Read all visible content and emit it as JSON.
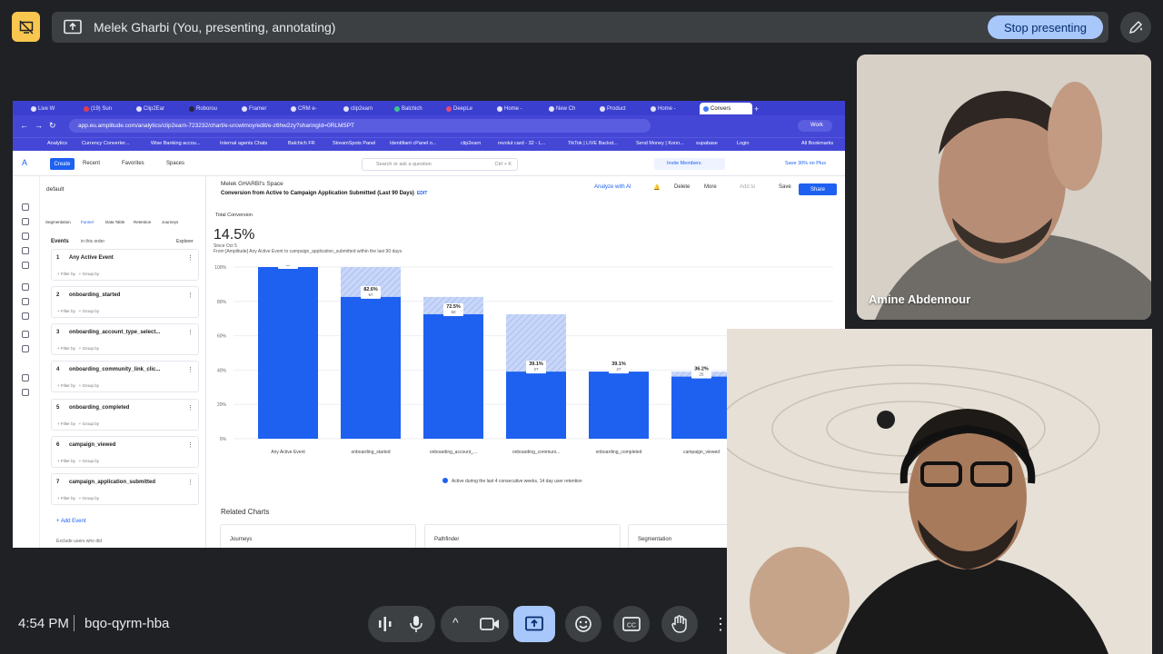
{
  "meeting": {
    "presenting_label": "Melek Gharbi (You, presenting, annotating)",
    "stop_button": "Stop presenting",
    "time": "4:54 PM",
    "code": "bqo-qyrm-hba"
  },
  "participants": [
    {
      "name": "Amine Abdennour"
    }
  ],
  "browser": {
    "tabs": [
      "Live W",
      "(19) Sun",
      "Clip2Ear",
      "Roborou",
      "Framer",
      "CRM e-",
      "clip2earn",
      "Balchich",
      "DeepLe",
      "Home -",
      "New Ch",
      "Product",
      "Home -",
      "Convers"
    ],
    "url": "app.eu.amplitude.com/analytics/clip2earn-723232/chart/e-urcwtmoy/edit/e-z6hw2zy?sharingId=0RLMSPT",
    "profile": "Work",
    "bookmarks": [
      "Analytics",
      "Currency Converter...",
      "Wise Banking accou...",
      "Internal agents Chats",
      "Balchich FR",
      "StreamSpots Panel",
      "Identifiant cPanel o...",
      "clip2earn",
      "revolut card - 32 - L...",
      "TikTok | LIVE Backst...",
      "Send Money | Konn...",
      "supabase",
      "Login",
      "All Bookmarks"
    ]
  },
  "app": {
    "create": "Create",
    "nav": [
      "Recent",
      "Favorites",
      "Spaces"
    ],
    "search_placeholder": "Search or ask a question",
    "search_shortcut": "Ctrl + K",
    "invite": "Invite Members",
    "save_promo": "Save 30% on Plus",
    "project": "default",
    "left_tabs": [
      "Segmentation",
      "Funnel",
      "Data Table",
      "Retention",
      "Journeys"
    ],
    "events_label": "Events",
    "order_label": "in this order",
    "explorer": "Explorer",
    "filter_by": "+ Filter by",
    "group_by": "+ Group by",
    "events": [
      {
        "num": "1",
        "name": "Any Active Event"
      },
      {
        "num": "2",
        "name": "onboarding_started"
      },
      {
        "num": "3",
        "name": "onboarding_account_type_select..."
      },
      {
        "num": "4",
        "name": "onboarding_community_link_clic..."
      },
      {
        "num": "5",
        "name": "onboarding_completed"
      },
      {
        "num": "6",
        "name": "campaign_viewed"
      },
      {
        "num": "7",
        "name": "campaign_application_submitted"
      }
    ],
    "add_event": "+ Add Event",
    "exclude": "Exclude users who did",
    "crumb": "Melek GHARBI's Space",
    "chart_title": "Conversion from Active to Campaign Application Submitted (Last 90 Days)",
    "edit_tag": "EDIT",
    "analyze_ai": "Analyze with AI",
    "delete": "Delete",
    "more": "More",
    "add_to": "Add to",
    "save": "Save",
    "share": "Share",
    "total_conversion": "Total Conversion",
    "headline_pct": "14.5%",
    "since": "Since Oct 5",
    "from_to": "From [Amplitude] Any Active Event to campaign_application_submitted within the last 90 days.",
    "legend": "Active during the last 4 consecutive weeks, 14 day user retention",
    "related": "Related Charts",
    "related_cards": [
      "Journeys",
      "Pathfinder",
      "Segmentation"
    ]
  },
  "chart_data": {
    "type": "bar",
    "categories": [
      "Any Active Event",
      "onboarding_started",
      "onboarding_account_...",
      "onboarding_communi...",
      "onboarding_completed",
      "campaign_viewed"
    ],
    "values": [
      100,
      82.6,
      72.5,
      39.1,
      39.1,
      36.2
    ],
    "dropoff_base": [
      100,
      100,
      82.6,
      72.5,
      39.1,
      39.1
    ],
    "value_labels": [
      "100%",
      "82.6%",
      "72.5%",
      "39.1%",
      "39.1%",
      "36.2%"
    ],
    "count_labels": [
      "69",
      "57",
      "50",
      "27",
      "27",
      "25"
    ],
    "yticks": [
      "100%",
      "80%",
      "60%",
      "40%",
      "20%",
      "0%"
    ],
    "ylim": [
      0,
      100
    ],
    "colors": {
      "bar": "#1e61f0",
      "dropoff": "#c8d6f8"
    }
  }
}
